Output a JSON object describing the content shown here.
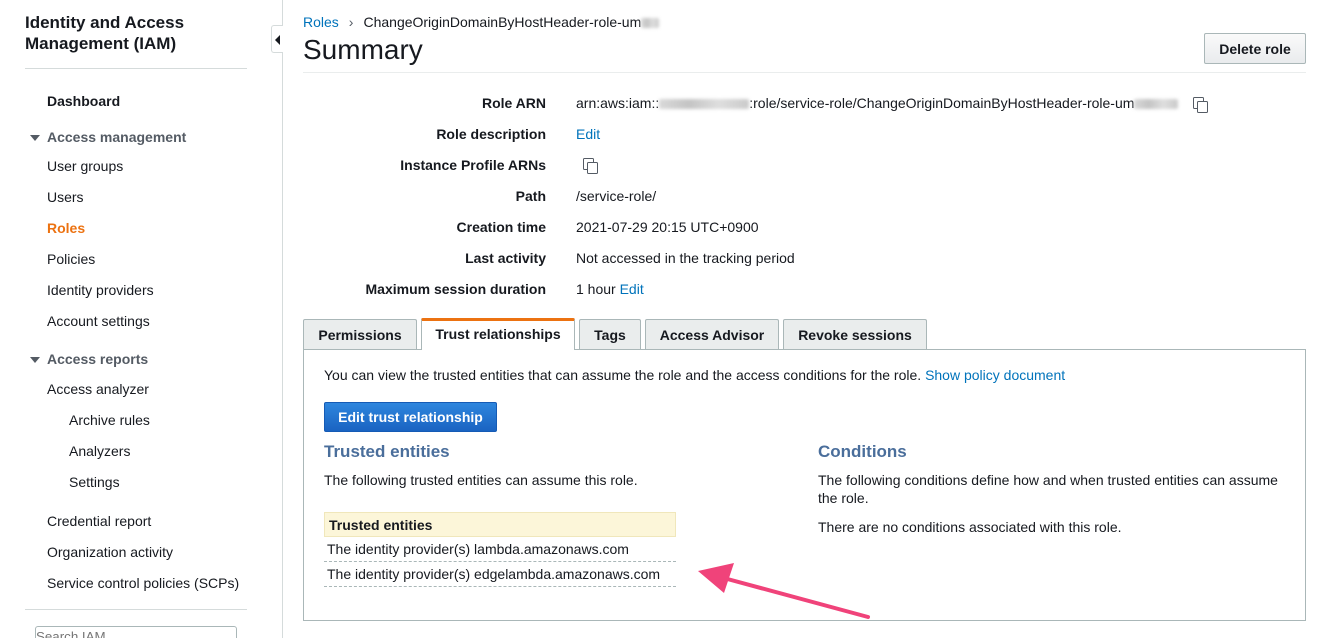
{
  "sidebar": {
    "title": "Identity and Access Management (IAM)",
    "dashboard": "Dashboard",
    "access_management": {
      "label": "Access management",
      "items": [
        "User groups",
        "Users",
        "Roles",
        "Policies",
        "Identity providers",
        "Account settings"
      ],
      "active": "Roles"
    },
    "access_reports": {
      "label": "Access reports",
      "items": [
        "Access analyzer",
        "Archive rules",
        "Analyzers",
        "Settings",
        "Credential report",
        "Organization activity",
        "Service control policies (SCPs)"
      ]
    },
    "search_placeholder": "Search IAM"
  },
  "breadcrumb": {
    "parent": "Roles",
    "current": "ChangeOriginDomainByHostHeader-role-um"
  },
  "page": {
    "title": "Summary",
    "delete_button": "Delete role"
  },
  "summary": {
    "role_arn_label": "Role ARN",
    "role_arn_prefix": "arn:aws:iam::",
    "role_arn_mid": ":role/service-role/ChangeOriginDomainByHostHeader-role-um",
    "role_description_label": "Role description",
    "role_description_value": "Edit",
    "instance_profile_label": "Instance Profile ARNs",
    "path_label": "Path",
    "path_value": "/service-role/",
    "creation_time_label": "Creation time",
    "creation_time_value": "2021-07-29 20:15 UTC+0900",
    "last_activity_label": "Last activity",
    "last_activity_value": "Not accessed in the tracking period",
    "max_session_label": "Maximum session duration",
    "max_session_value": "1 hour",
    "max_session_edit": "Edit"
  },
  "tabs": [
    "Permissions",
    "Trust relationships",
    "Tags",
    "Access Advisor",
    "Revoke sessions"
  ],
  "active_tab": "Trust relationships",
  "trust": {
    "intro": "You can view the trusted entities that can assume the role and the access conditions for the role.",
    "show_policy": "Show policy document",
    "edit_button": "Edit trust relationship",
    "trusted_heading": "Trusted entities",
    "trusted_desc": "The following trusted entities can assume this role.",
    "table_header": "Trusted entities",
    "rows": [
      "The identity provider(s) lambda.amazonaws.com",
      "The identity provider(s) edgelambda.amazonaws.com"
    ],
    "conditions_heading": "Conditions",
    "conditions_desc": "The following conditions define how and when trusted entities can assume the role.",
    "conditions_none": "There are no conditions associated with this role."
  },
  "colors": {
    "accent": "#ec7211",
    "link": "#0073bb",
    "primary_button": "#1a63c2",
    "annotation_arrow": "#f0437a"
  }
}
